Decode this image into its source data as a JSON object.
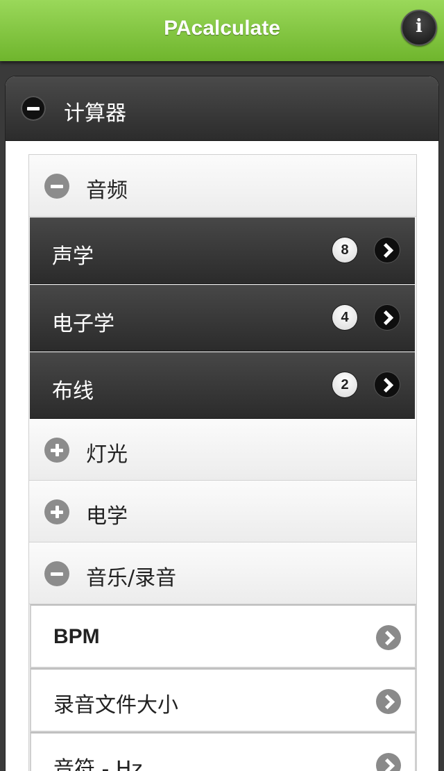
{
  "header": {
    "title": "PAcalculate",
    "info_icon": "info-icon",
    "info_glyph": "i"
  },
  "panel": {
    "title": "计算器",
    "state_icon": "minus-icon"
  },
  "groups": [
    {
      "label": "音频",
      "state_icon": "minus-icon",
      "items": [
        {
          "label": "声学",
          "count": "8"
        },
        {
          "label": "电子学",
          "count": "4"
        },
        {
          "label": "布线",
          "count": "2"
        }
      ]
    },
    {
      "label": "灯光",
      "state_icon": "plus-icon"
    },
    {
      "label": "电学",
      "state_icon": "plus-icon"
    },
    {
      "label": "音乐/录音",
      "state_icon": "minus-icon",
      "items": [
        {
          "label": "BPM"
        },
        {
          "label": "录音文件大小"
        },
        {
          "label": "音符 - Hz"
        }
      ]
    }
  ],
  "colors": {
    "header_green": "#7cc23c",
    "dark_row": "#333333",
    "background": "#3a3a3a"
  }
}
